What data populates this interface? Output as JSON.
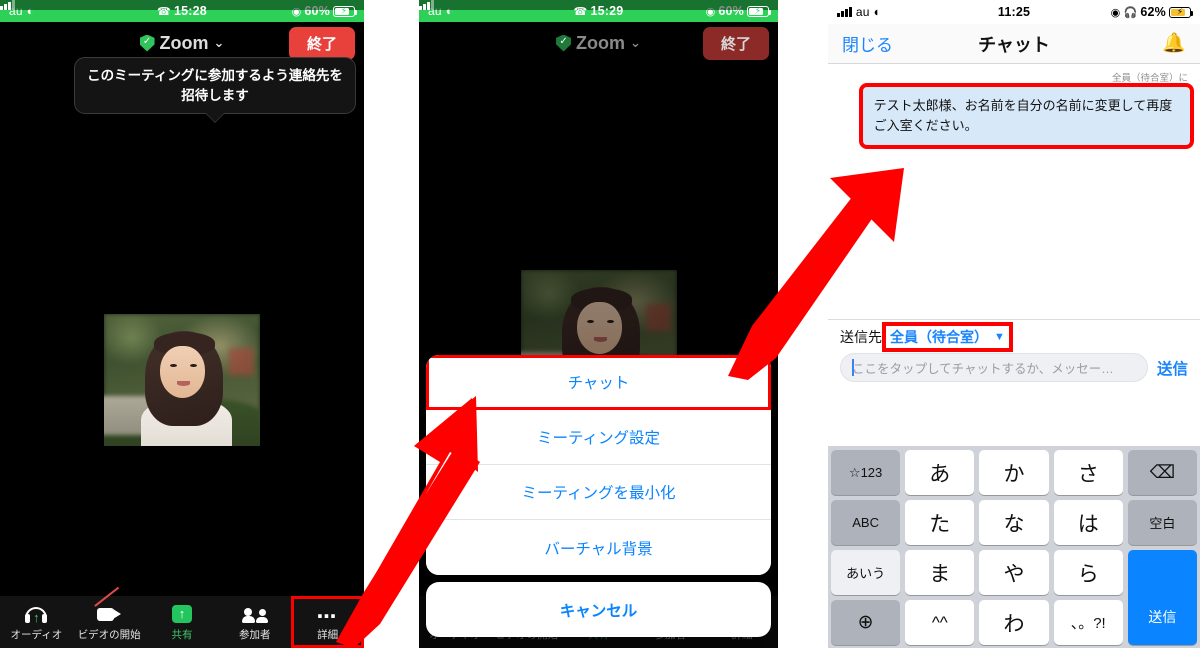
{
  "panel_left": {
    "statusbar": {
      "carrier": "au",
      "time": "15:28",
      "battery": "60%",
      "call_icon": "phone-icon",
      "location_icon": "location-icon"
    },
    "header": {
      "title": "Zoom",
      "end_button": "終了",
      "shield_icon": "shield-check-icon",
      "chevron": "⌄"
    },
    "tooltip": "このミーティングに参加するよう連絡先を招待します",
    "toolbar": [
      {
        "label": "オーディオ",
        "icon": "headset-audio-icon",
        "highlighted": false
      },
      {
        "label": "ビデオの開始",
        "icon": "video-off-icon",
        "highlighted": false
      },
      {
        "label": "共有",
        "icon": "share-up-arrow-icon",
        "highlighted": false
      },
      {
        "label": "参加者",
        "icon": "participants-icon",
        "highlighted": false
      },
      {
        "label": "詳細",
        "icon": "more-dots-icon",
        "highlighted": true
      }
    ]
  },
  "panel_middle": {
    "statusbar": {
      "carrier": "au",
      "time": "15:29",
      "battery": "60%"
    },
    "header": {
      "title": "Zoom",
      "end_button": "終了"
    },
    "actionsheet": [
      {
        "label": "チャット",
        "highlighted": true
      },
      {
        "label": "ミーティング設定",
        "highlighted": false
      },
      {
        "label": "ミーティングを最小化",
        "highlighted": false
      },
      {
        "label": "バーチャル背景",
        "highlighted": false
      }
    ],
    "cancel": "キャンセル"
  },
  "panel_right": {
    "statusbar": {
      "carrier": "au",
      "time": "11:25",
      "battery": "62%",
      "headphone_icon": "headphones-icon",
      "location_icon": "location-icon"
    },
    "nav": {
      "close": "閉じる",
      "title": "チャット",
      "bell_icon": "bell-icon"
    },
    "message": {
      "meta": "全員（待合室）に",
      "text": "テスト太郎様、お名前を自分の名前に変更して再度ご入室ください。",
      "highlighted": true
    },
    "compose": {
      "send_to_label": "送信先",
      "recipient": "全員（待合室）",
      "recipient_chevron": "⌄",
      "placeholder": "ここをタップしてチャットするか、メッセー…",
      "send_label": "送信"
    },
    "keyboard": {
      "rows": [
        [
          {
            "label": "☆123",
            "style": "gray small"
          },
          {
            "label": "あ",
            "style": ""
          },
          {
            "label": "か",
            "style": ""
          },
          {
            "label": "さ",
            "style": ""
          },
          {
            "label": "⌫",
            "style": "gray small"
          }
        ],
        [
          {
            "label": "ABC",
            "style": "gray small"
          },
          {
            "label": "た",
            "style": ""
          },
          {
            "label": "な",
            "style": ""
          },
          {
            "label": "は",
            "style": ""
          },
          {
            "label": "空白",
            "style": "gray small"
          }
        ],
        [
          {
            "label": "あいう",
            "style": "lite"
          },
          {
            "label": "ま",
            "style": ""
          },
          {
            "label": "や",
            "style": ""
          },
          {
            "label": "ら",
            "style": ""
          },
          {
            "label": "送信",
            "style": "blue"
          }
        ],
        [
          {
            "label": "⊕",
            "style": "gray"
          },
          {
            "label": "^^",
            "style": "small"
          },
          {
            "label": "わ",
            "style": ""
          },
          {
            "label": "、。?!",
            "style": "small"
          }
        ]
      ]
    }
  },
  "colors": {
    "status_green": "#2ed158",
    "accent_blue": "#1a84ff",
    "highlight_red": "#ff0000",
    "end_red": "#e8403a",
    "bubble_blue": "#d7e8f8"
  }
}
